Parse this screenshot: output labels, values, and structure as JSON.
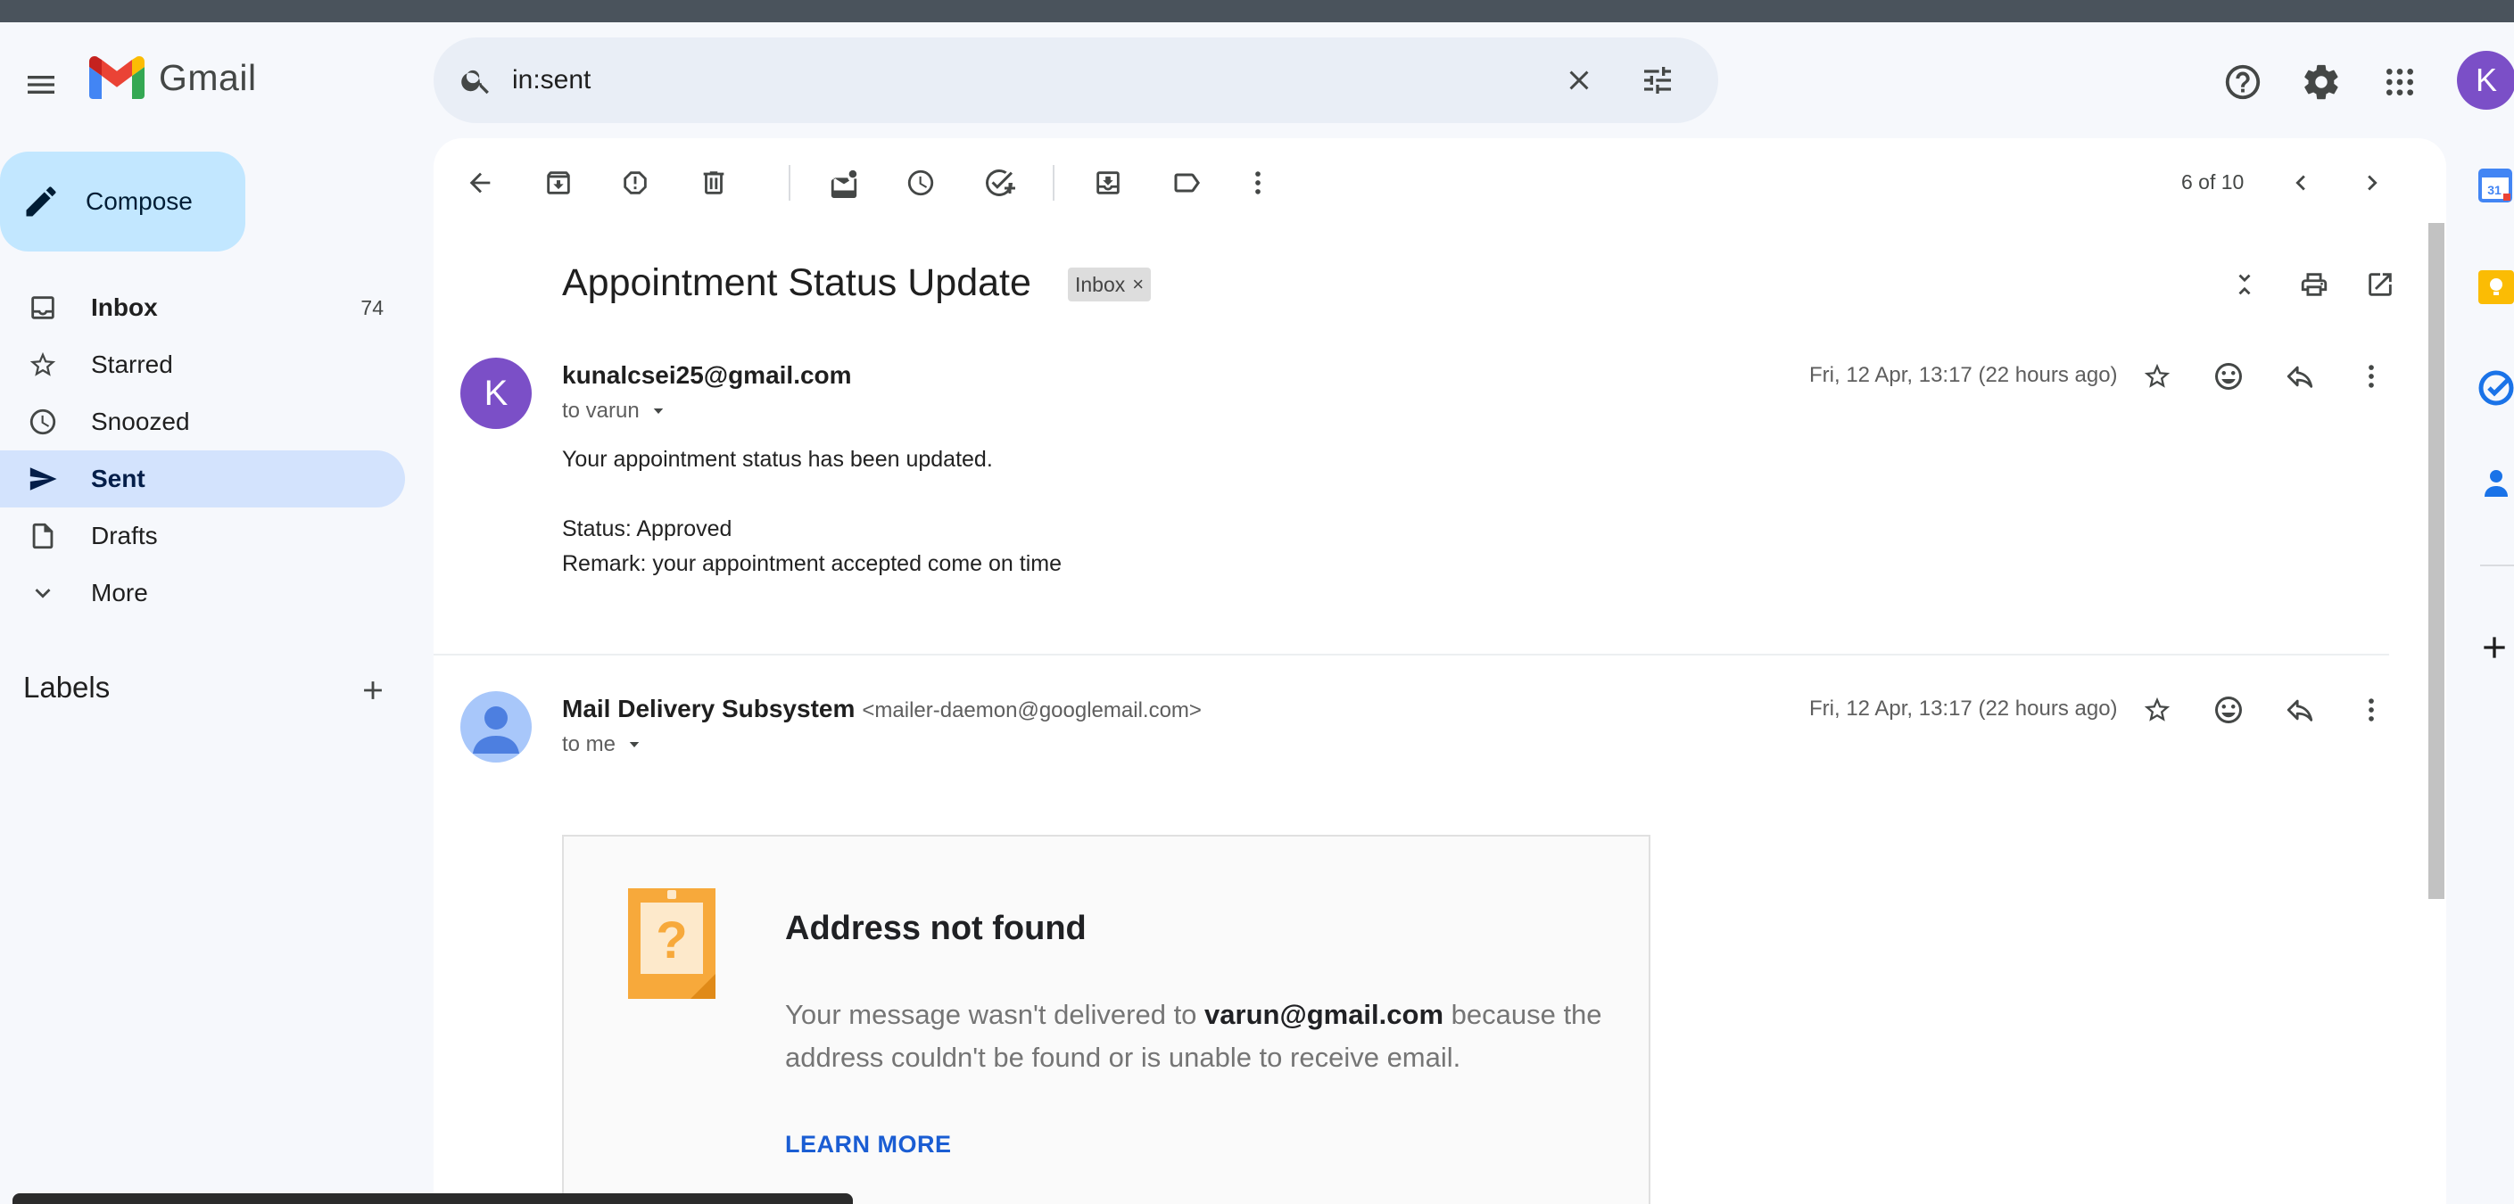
{
  "app": {
    "name": "Gmail"
  },
  "search": {
    "value": "in:sent"
  },
  "compose": {
    "label": "Compose"
  },
  "nav": {
    "items": [
      {
        "label": "Inbox",
        "count": "74"
      },
      {
        "label": "Starred"
      },
      {
        "label": "Snoozed"
      },
      {
        "label": "Sent"
      },
      {
        "label": "Drafts"
      },
      {
        "label": "More"
      }
    ]
  },
  "labels": {
    "title": "Labels"
  },
  "header": {
    "avatar_letter": "K"
  },
  "pager": {
    "text": "6 of 10"
  },
  "thread": {
    "subject": "Appointment Status Update",
    "label_chip": "Inbox",
    "messages": [
      {
        "avatar_letter": "K",
        "sender": "kunalcsei25@gmail.com",
        "recipient": "to varun",
        "date": "Fri, 12 Apr, 13:17 (22 hours ago)",
        "body": [
          "Your appointment status has been updated.",
          "Status: Approved",
          "Remark: your appointment accepted come on time"
        ]
      },
      {
        "sender": "Mail Delivery Subsystem",
        "sender_address": "<mailer-daemon@googlemail.com>",
        "recipient": "to me",
        "date": "Fri, 12 Apr, 13:17 (22 hours ago)",
        "bounce": {
          "title": "Address not found",
          "text_before": "Your message wasn't delivered to ",
          "address": "varun@gmail.com",
          "text_after": " because the address couldn't be found or is unable to receive email.",
          "link": "LEARN MORE"
        }
      }
    ]
  },
  "side_panel": {
    "calendar_day": "31"
  },
  "colors": {
    "accent": "#0b57d0",
    "compose_bg": "#c2e7ff",
    "active_nav": "#d3e3fd",
    "avatar_purple": "#7b4fc7",
    "link": "#1a5dd3"
  }
}
